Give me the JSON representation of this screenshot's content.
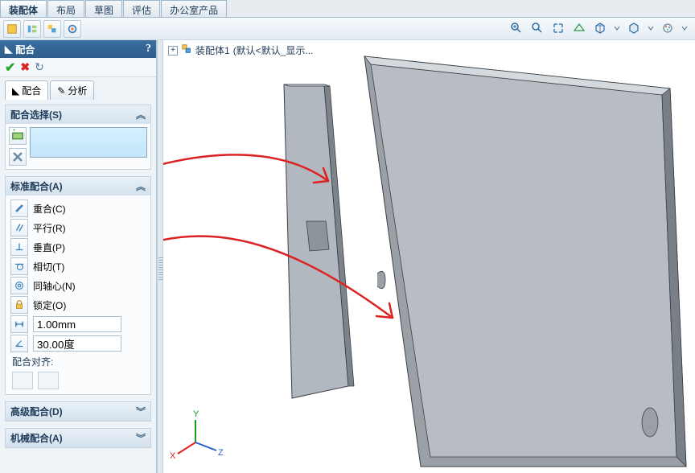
{
  "tabs": {
    "assembly": "装配体",
    "layout": "布局",
    "sketch": "草图",
    "review": "评估",
    "office": "办公室产品"
  },
  "pm": {
    "title": "配合",
    "subtabs": {
      "mate": "配合",
      "analyze": "分析"
    },
    "sec_select": "配合选择(S)",
    "sec_std": "标准配合(A)",
    "std": {
      "coincident": "重合(C)",
      "parallel": "平行(R)",
      "perpendicular": "垂直(P)",
      "tangent": "相切(T)",
      "concentric": "同轴心(N)",
      "lock": "锁定(O)",
      "dist": "1.00mm",
      "angle": "30.00度",
      "align_lbl": "配合对齐:"
    },
    "sec_adv": "高级配合(D)",
    "sec_mech": "机械配合(A)"
  },
  "crumb": {
    "name": "装配体1",
    "state": "(默认<默认_显示..."
  },
  "triad": {
    "x": "X",
    "y": "Y",
    "z": "Z"
  }
}
